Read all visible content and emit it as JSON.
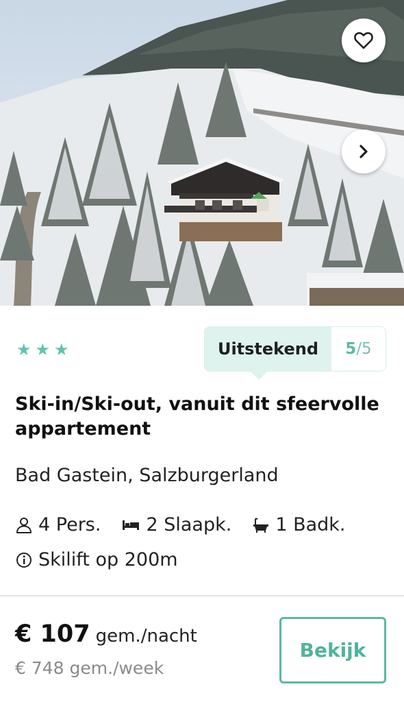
{
  "listing": {
    "star_count": 3,
    "rating_label": "Uitstekend",
    "rating_score": "5",
    "rating_max": "/5",
    "title": "Ski-in/Ski-out, vanuit dit sfeervolle appartement",
    "location": "Bad Gastein, Salzburgerland",
    "features": {
      "persons": "4 Pers.",
      "bedrooms": "2 Slaapk.",
      "bathrooms": "1 Badk.",
      "skilift": "Skilift op 200m"
    },
    "price_main": "€ 107",
    "price_unit": "gem./nacht",
    "price_week": "€ 748 gem./week",
    "cta_label": "Bekijk"
  },
  "icons": {
    "favorite": "heart-icon",
    "next": "chevron-right-icon",
    "persons": "person-icon",
    "bedrooms": "bed-icon",
    "bathrooms": "bathtub-icon",
    "info": "info-icon"
  },
  "colors": {
    "accent": "#5ab9a3",
    "star": "#5fc4ae",
    "rating_bg": "#def3ee"
  }
}
